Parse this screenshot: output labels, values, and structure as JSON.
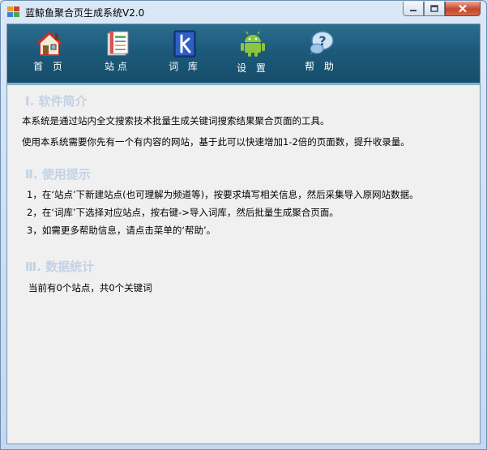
{
  "window": {
    "title": "蓝鲸鱼聚合页生成系统V2.0"
  },
  "toolbar": {
    "items": [
      {
        "label": "首 页",
        "icon": "house-icon"
      },
      {
        "label": "站点",
        "icon": "books-icon"
      },
      {
        "label": "词 库",
        "icon": "letter-k-icon"
      },
      {
        "label": "设 置",
        "icon": "android-icon"
      },
      {
        "label": "帮 助",
        "icon": "help-icon"
      }
    ]
  },
  "sections": [
    {
      "title": "Ⅰ. 软件简介",
      "lines": [
        "本系统是通过站内全文搜索技术批量生成关键词搜索结果聚合页面的工具。",
        "使用本系统需要你先有一个有内容的网站，基于此可以快速增加1-2倍的页面数，提升收录量。"
      ]
    },
    {
      "title": "Ⅱ. 使用提示",
      "lines": [
        "1，在‘站点’下新建站点(也可理解为频道等)，按要求填写相关信息，然后采集导入原网站数据。",
        "2，在‘词库’下选择对应站点，按右键->导入词库，然后批量生成聚合页面。",
        "3，如需更多帮助信息，请点击菜单的‘帮助’。"
      ]
    },
    {
      "title": "Ⅲ. 数据统计",
      "lines": [
        "当前有0个站点，共0个关键词"
      ]
    }
  ],
  "colors": {
    "toolbar": "#1c5a7a",
    "section_title": "#c3d2e3",
    "client_bg": "#f0f0f0"
  }
}
